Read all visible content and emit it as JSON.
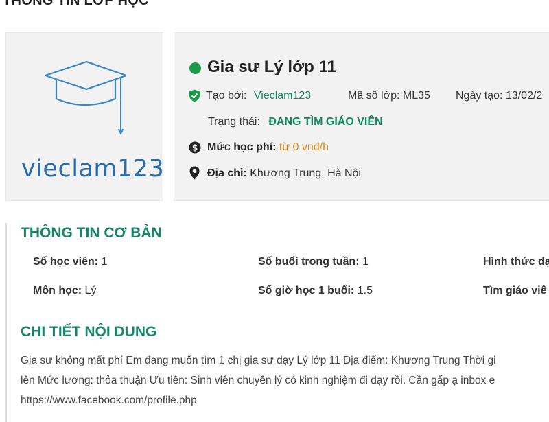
{
  "page": {
    "heading": "THÔNG TIN LỚP HỌC"
  },
  "logo": {
    "text": "vieclam123"
  },
  "class_info": {
    "title": "Gia sư Lý lớp 11",
    "created_by_label": "Tạo bởi:",
    "created_by_value": "Vieclam123",
    "code_label": "Mã số lớp:",
    "code_value": "ML35",
    "date_label": "Ngày tạo:",
    "date_value": "13/02/2",
    "status_label": "Trạng thái:",
    "status_value": "ĐANG TÌM GIÁO VIÊN",
    "fee_label": "Mức học phí:",
    "fee_value": "từ 0 vnđ/h",
    "address_label": "Địa chỉ:",
    "address_value": "Khương Trung, Hà Nội"
  },
  "basic_info": {
    "title": "THÔNG TIN CƠ BẢN",
    "students_label": "Số học viên:",
    "students_value": "1",
    "sessions_label": "Số buổi trong tuần:",
    "sessions_value": "1",
    "format_label": "Hình thức dạ",
    "subject_label": "Môn học:",
    "subject_value": "Lý",
    "hours_label": "Số giờ học 1 buổi:",
    "hours_value": "1.5",
    "find_label": "Tìm giáo viê"
  },
  "detail": {
    "title": "CHI TIẾT NỘI DUNG",
    "line1": "Gia sư không mất phí Em đang muốn tìm 1 chị gia sư dạy Lý lớp 11 Địa điểm: Khương Trung Thời gi",
    "line2": "lên Mức lương: thỏa thuận Ưu tiên: Sinh viên chuyên lý có kinh nghiệm đi dạy rồi. Cần gấp ạ inbox e",
    "line3": "https://www.facebook.com/profile.php"
  },
  "colors": {
    "accent": "#16866a",
    "status_green": "#1a9a4a",
    "fee_orange": "#e08a16",
    "logo_blue": "#2a6aa8"
  },
  "icons": [
    "shield-check-icon",
    "dollar-coin-icon",
    "map-pin-icon",
    "graduation-cap-icon"
  ]
}
